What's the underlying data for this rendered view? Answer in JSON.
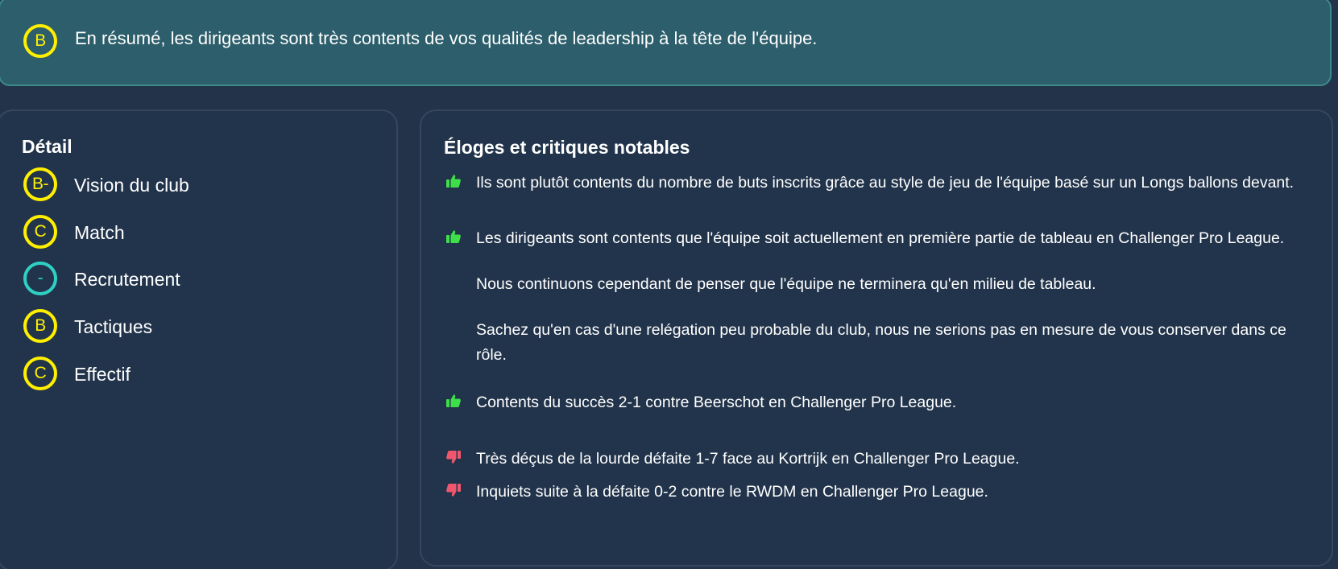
{
  "summary": {
    "grade": "B",
    "text": "En résumé, les dirigeants sont très contents de vos qualités de leadership à la tête de l'équipe."
  },
  "detail": {
    "title": "Détail",
    "items": [
      {
        "grade": "B-",
        "label": "Vision du club",
        "color": "#ffef00"
      },
      {
        "grade": "C",
        "label": "Match",
        "color": "#ffef00"
      },
      {
        "grade": "-",
        "label": "Recrutement",
        "color": "#2fd0c4"
      },
      {
        "grade": "B",
        "label": "Tactiques",
        "color": "#ffef00"
      },
      {
        "grade": "C",
        "label": "Effectif",
        "color": "#ffef00"
      }
    ]
  },
  "feedback": {
    "title": "Éloges et critiques notables",
    "items": [
      {
        "sentiment": "positive",
        "icon": "thumbs-up-icon",
        "paragraphs": [
          "Ils sont plutôt contents du nombre de buts inscrits grâce au style de jeu de l'équipe basé sur un Longs ballons devant."
        ]
      },
      {
        "sentiment": "positive",
        "icon": "thumbs-up-icon",
        "paragraphs": [
          "Les dirigeants sont contents que l'équipe soit actuellement en première partie de tableau en Challenger Pro League.",
          "Nous continuons cependant de penser que l'équipe ne terminera qu'en milieu de tableau.",
          "Sachez qu'en cas d'une relégation peu probable du club, nous ne serions pas en mesure de vous conserver dans ce rôle."
        ]
      },
      {
        "sentiment": "positive",
        "icon": "thumbs-up-icon",
        "paragraphs": [
          "Contents du succès 2-1 contre Beerschot en Challenger Pro League."
        ]
      },
      {
        "sentiment": "negative",
        "icon": "thumbs-down-icon",
        "paragraphs": [
          "Très déçus de la lourde défaite 1-7 face au Kortrijk en Challenger Pro League."
        ]
      },
      {
        "sentiment": "negative",
        "icon": "thumbs-down-icon",
        "paragraphs": [
          "Inquiets suite à la défaite 0-2 contre le RWDM en Challenger Pro League."
        ]
      }
    ]
  },
  "colors": {
    "positive": "#3ee04a",
    "negative": "#f0566e",
    "grade_yellow": "#ffef00",
    "grade_teal": "#2fd0c4"
  }
}
